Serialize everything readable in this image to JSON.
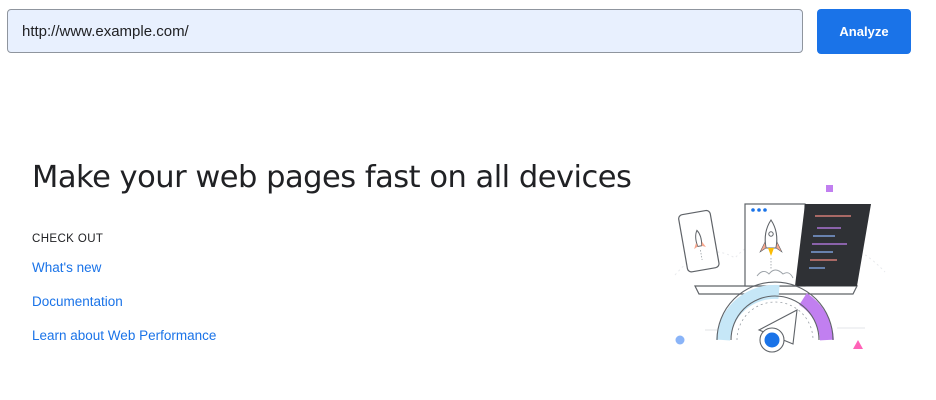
{
  "search": {
    "url_value": "http://www.example.com/",
    "analyze_label": "Analyze"
  },
  "hero": {
    "title": "Make your web pages fast on all devices",
    "check_out_label": "CHECK OUT",
    "links": [
      {
        "label": "What's new"
      },
      {
        "label": "Documentation"
      },
      {
        "label": "Learn about Web Performance"
      }
    ]
  },
  "colors": {
    "accent": "#1a73e8",
    "input_background": "#e8f0fe",
    "title_text": "#202124",
    "gauge_blue": "#c6e7f7",
    "gauge_purple": "#c17ff0",
    "dark_panel": "#2f3135"
  },
  "icons": {
    "illustration": "devices-speed-illustration"
  }
}
